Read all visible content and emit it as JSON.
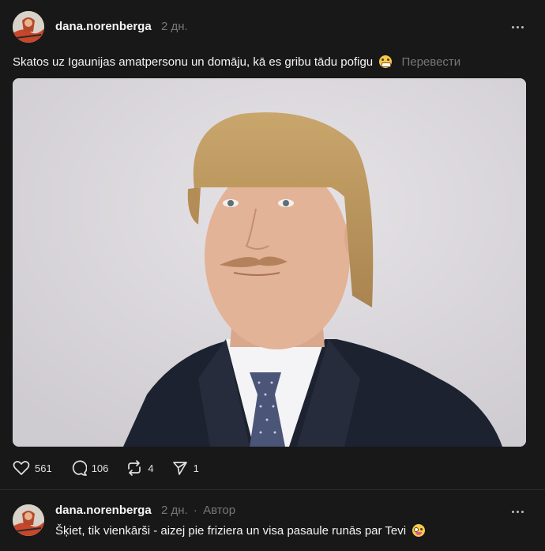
{
  "post": {
    "username": "dana.norenberga",
    "time": "2 дн.",
    "text": "Skatos uz Igaunijas amatpersonu un domāju, kā es gribu tādu pofigu",
    "emoji": "grimacing-face",
    "translate_label": "Перевести",
    "likes": "561",
    "replies": "106",
    "reposts": "4",
    "shares": "1"
  },
  "reply": {
    "username": "dana.norenberga",
    "time": "2 дн.",
    "separator": "·",
    "author_badge": "Автор",
    "text": "Šķiet, tik vienkārši - aizej pie friziera un visa pasaule runās par Tevi",
    "emoji": "zany-face"
  },
  "colors": {
    "background": "#181818",
    "text": "#f3f5f7",
    "muted": "#777777"
  }
}
